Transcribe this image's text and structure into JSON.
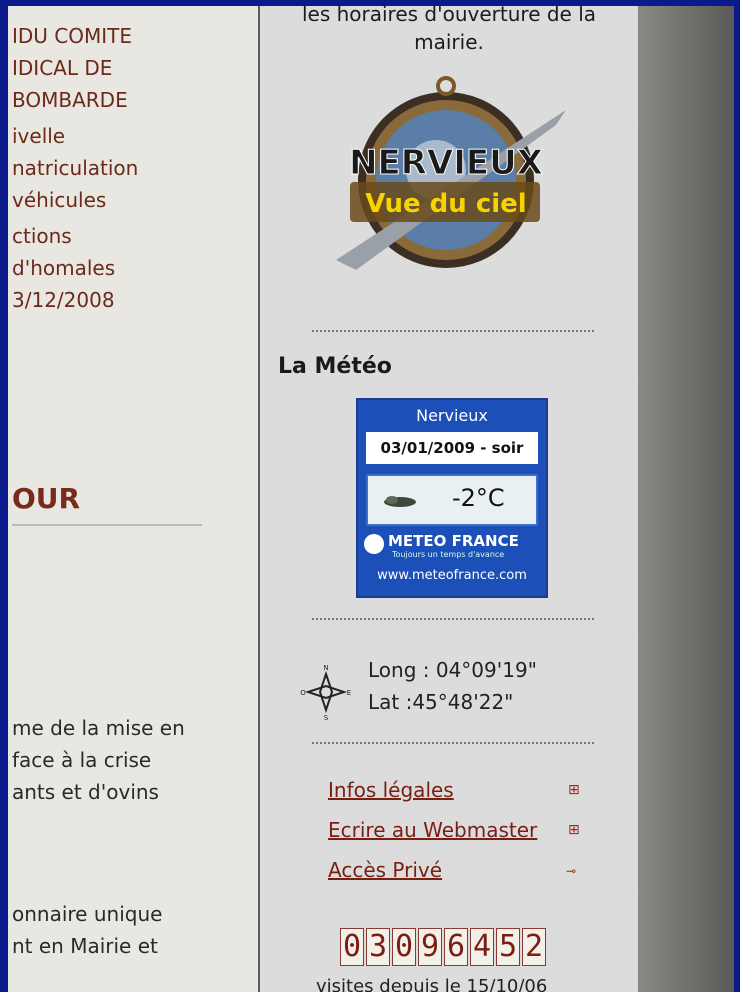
{
  "left_column": {
    "items": [
      [
        "IDU COMITE",
        "IDICAL DE",
        "BOMBARDE"
      ],
      [
        "ivelle",
        "natriculation",
        "véhicules"
      ],
      [
        "ctions",
        "d'homales",
        "3/12/2008"
      ]
    ],
    "heading": "OUR",
    "paragraphs": [
      [
        "me de la mise en",
        "face à la crise",
        "ants et d'ovins"
      ],
      [
        "onnaire unique",
        "nt en Mairie et"
      ]
    ]
  },
  "right_column": {
    "top_line1": "les horaires d'ouverture de la",
    "top_line2": "mairie.",
    "logo": {
      "word1": "NERVIEUX",
      "word2": "Vue du ciel"
    },
    "meteo": {
      "title": "La Météo",
      "city": "Nervieux",
      "date": "03/01/2009 - soir",
      "temperature": "-2°C",
      "brand": "METEO FRANCE",
      "tagline": "Toujours un temps d'avance",
      "url": "www.meteofrance.com"
    },
    "coordinates": {
      "long": "Long : 04°09'19\"",
      "lat": "Lat :45°48'22\""
    },
    "links": [
      {
        "label": "Infos légales",
        "icon": "plus-box-icon"
      },
      {
        "label": "Ecrire au Webmaster",
        "icon": "plus-box-icon"
      },
      {
        "label": "Accès Privé",
        "icon": "key-icon"
      }
    ],
    "counter": {
      "digits": [
        "0",
        "3",
        "0",
        "9",
        "6",
        "4",
        "5",
        "2"
      ],
      "caption": "visites depuis le 15/10/06"
    }
  },
  "colors": {
    "link": "#7a1e14",
    "meteo_blue": "#1d4fb8",
    "background": "#0a1a8a"
  }
}
